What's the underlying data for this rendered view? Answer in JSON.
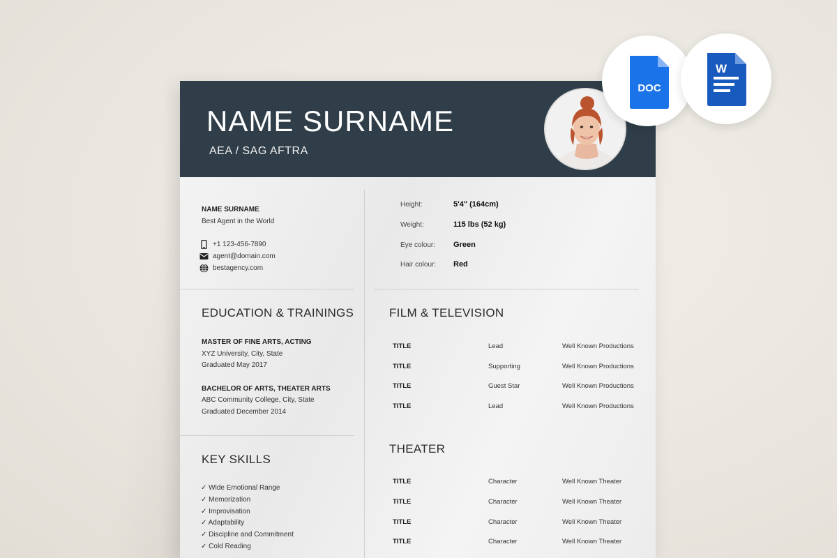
{
  "header": {
    "name": "NAME SURNAME",
    "union": "AEA / SAG AFTRA"
  },
  "contact": {
    "name": "NAME SURNAME",
    "agent": "Best Agent in the World",
    "phone": "+1 123-456-7890",
    "email": "agent@domain.com",
    "web": "bestagency.com"
  },
  "stats": [
    {
      "label": "Height:",
      "value": "5'4\" (164cm)"
    },
    {
      "label": "Weight:",
      "value": "115 lbs (52 kg)"
    },
    {
      "label": "Eye colour:",
      "value": "Green"
    },
    {
      "label": "Hair colour:",
      "value": "Red"
    }
  ],
  "education": {
    "title": "EDUCATION & TRAININGS",
    "items": [
      {
        "degree": "MASTER OF FINE ARTS, ACTING",
        "school": "XYZ University, City, State",
        "date": "Graduated May 2017"
      },
      {
        "degree": "BACHELOR OF ARTS, THEATER ARTS",
        "school": "ABC Community College, City, State",
        "date": "Graduated December 2014"
      }
    ]
  },
  "skills": {
    "title": "KEY SKILLS",
    "items": [
      "Wide Emotional Range",
      "Memorization",
      "Improvisation",
      "Adaptability",
      "Discipline and Commitment",
      "Cold Reading"
    ]
  },
  "film": {
    "title": "FILM & TELEVISION",
    "rows": [
      {
        "title": "TITLE",
        "role": "Lead",
        "production": "Well Known Productions"
      },
      {
        "title": "TITLE",
        "role": "Supporting",
        "production": "Well Known Productions"
      },
      {
        "title": "TITLE",
        "role": "Guest Star",
        "production": "Well Known Productions"
      },
      {
        "title": "TITLE",
        "role": "Lead",
        "production": "Well Known Productions"
      }
    ]
  },
  "theater": {
    "title": "THEATER",
    "rows": [
      {
        "title": "TITLE",
        "role": "Character",
        "production": "Well Known Theater"
      },
      {
        "title": "TITLE",
        "role": "Character",
        "production": "Well Known Theater"
      },
      {
        "title": "TITLE",
        "role": "Character",
        "production": "Well Known Theater"
      },
      {
        "title": "TITLE",
        "role": "Character",
        "production": "Well Known Theater"
      }
    ]
  },
  "badges": {
    "doc_label": "DOC",
    "word_label": "W"
  },
  "colors": {
    "header": "#2f3e48",
    "doc_blue": "#1a73e8",
    "word_blue": "#185abd"
  }
}
